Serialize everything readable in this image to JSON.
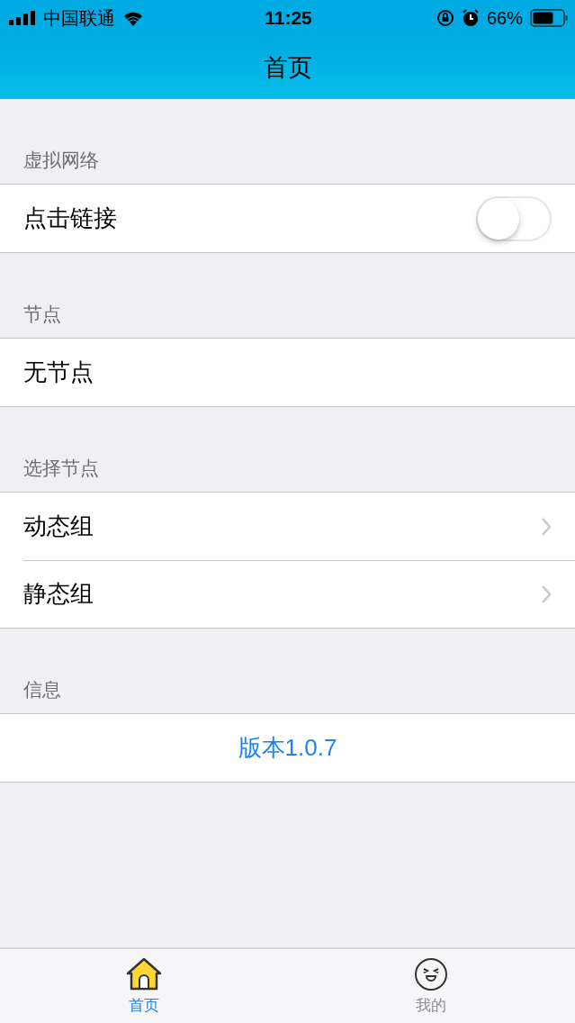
{
  "status_bar": {
    "carrier": "中国联通",
    "time": "11:25",
    "battery": "66%"
  },
  "nav": {
    "title": "首页"
  },
  "sections": [
    {
      "header": "虚拟网络",
      "rows": [
        {
          "kind": "toggle",
          "label": "点击链接",
          "on": false
        }
      ]
    },
    {
      "header": "节点",
      "rows": [
        {
          "kind": "plain",
          "label": "无节点"
        }
      ]
    },
    {
      "header": "选择节点",
      "rows": [
        {
          "kind": "disclosure",
          "label": "动态组"
        },
        {
          "kind": "disclosure",
          "label": "静态组"
        }
      ]
    },
    {
      "header": "信息",
      "rows": [
        {
          "kind": "link",
          "label": "版本1.0.7"
        }
      ]
    }
  ],
  "tab_bar": {
    "tabs": [
      {
        "label": "首页",
        "kind": "home",
        "selected": true
      },
      {
        "label": "我的",
        "kind": "profile",
        "selected": false
      }
    ]
  }
}
